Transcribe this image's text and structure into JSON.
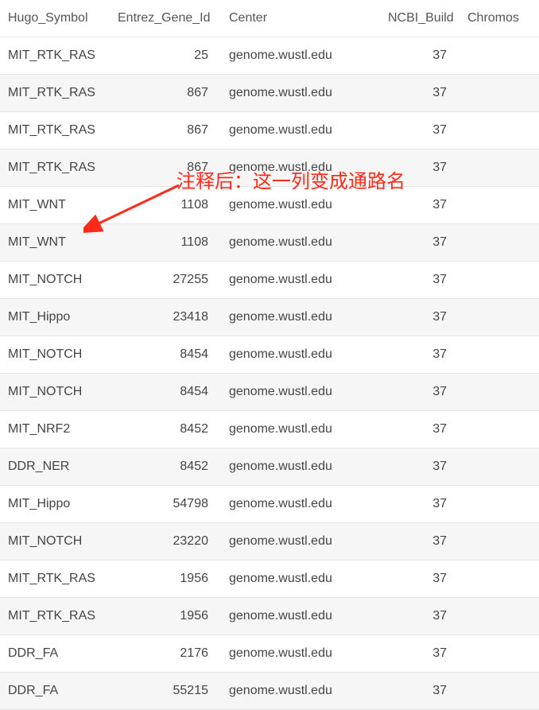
{
  "headers": {
    "hugo": "Hugo_Symbol",
    "entrez": "Entrez_Gene_Id",
    "center": "Center",
    "ncbi": "NCBI_Build",
    "chrom": "Chromos"
  },
  "rows": [
    {
      "hugo": "MIT_RTK_RAS",
      "entrez": "25",
      "center": "genome.wustl.edu",
      "ncbi": "37",
      "chrom": ""
    },
    {
      "hugo": "MIT_RTK_RAS",
      "entrez": "867",
      "center": "genome.wustl.edu",
      "ncbi": "37",
      "chrom": ""
    },
    {
      "hugo": "MIT_RTK_RAS",
      "entrez": "867",
      "center": "genome.wustl.edu",
      "ncbi": "37",
      "chrom": ""
    },
    {
      "hugo": "MIT_RTK_RAS",
      "entrez": "867",
      "center": "genome.wustl.edu",
      "ncbi": "37",
      "chrom": ""
    },
    {
      "hugo": "MIT_WNT",
      "entrez": "1108",
      "center": "genome.wustl.edu",
      "ncbi": "37",
      "chrom": ""
    },
    {
      "hugo": "MIT_WNT",
      "entrez": "1108",
      "center": "genome.wustl.edu",
      "ncbi": "37",
      "chrom": ""
    },
    {
      "hugo": "MIT_NOTCH",
      "entrez": "27255",
      "center": "genome.wustl.edu",
      "ncbi": "37",
      "chrom": ""
    },
    {
      "hugo": "MIT_Hippo",
      "entrez": "23418",
      "center": "genome.wustl.edu",
      "ncbi": "37",
      "chrom": ""
    },
    {
      "hugo": "MIT_NOTCH",
      "entrez": "8454",
      "center": "genome.wustl.edu",
      "ncbi": "37",
      "chrom": ""
    },
    {
      "hugo": "MIT_NOTCH",
      "entrez": "8454",
      "center": "genome.wustl.edu",
      "ncbi": "37",
      "chrom": ""
    },
    {
      "hugo": "MIT_NRF2",
      "entrez": "8452",
      "center": "genome.wustl.edu",
      "ncbi": "37",
      "chrom": ""
    },
    {
      "hugo": "DDR_NER",
      "entrez": "8452",
      "center": "genome.wustl.edu",
      "ncbi": "37",
      "chrom": ""
    },
    {
      "hugo": "MIT_Hippo",
      "entrez": "54798",
      "center": "genome.wustl.edu",
      "ncbi": "37",
      "chrom": ""
    },
    {
      "hugo": "MIT_NOTCH",
      "entrez": "23220",
      "center": "genome.wustl.edu",
      "ncbi": "37",
      "chrom": ""
    },
    {
      "hugo": "MIT_RTK_RAS",
      "entrez": "1956",
      "center": "genome.wustl.edu",
      "ncbi": "37",
      "chrom": ""
    },
    {
      "hugo": "MIT_RTK_RAS",
      "entrez": "1956",
      "center": "genome.wustl.edu",
      "ncbi": "37",
      "chrom": ""
    },
    {
      "hugo": "DDR_FA",
      "entrez": "2176",
      "center": "genome.wustl.edu",
      "ncbi": "37",
      "chrom": ""
    },
    {
      "hugo": "DDR_FA",
      "entrez": "55215",
      "center": "genome.wustl.edu",
      "ncbi": "37",
      "chrom": ""
    }
  ],
  "annotation": {
    "text": "注释后：这一列变成通路名",
    "color": "#ff2a1a"
  }
}
